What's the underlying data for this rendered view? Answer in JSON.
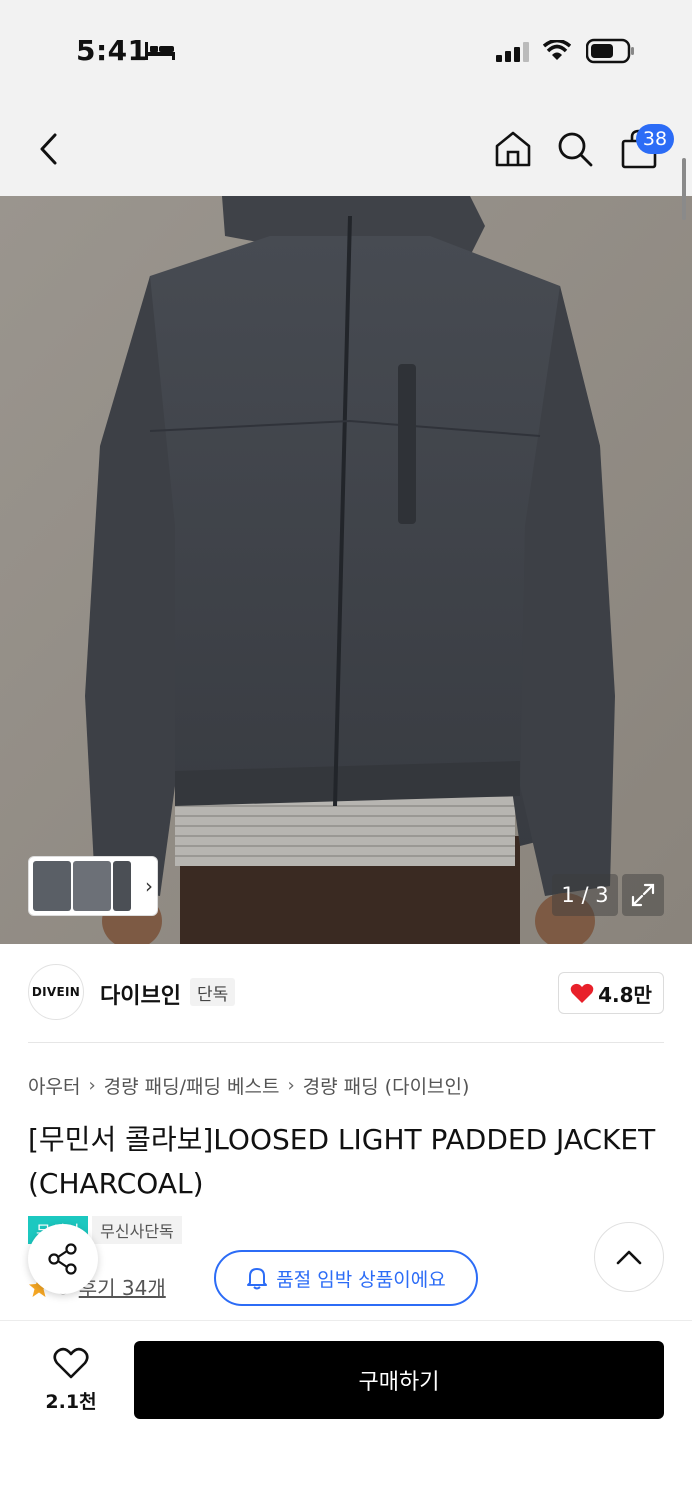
{
  "status_bar": {
    "time": "5:41"
  },
  "nav": {
    "cart_count": "38"
  },
  "gallery": {
    "page_indicator": "1 / 3"
  },
  "brand": {
    "logo_text": "DIVEIN",
    "name": "다이브인",
    "tag": "단독",
    "like_count": "4.8만"
  },
  "breadcrumb": [
    "아우터",
    "경량 패딩/패딩 베스트",
    "경량 패딩 (다이브인)"
  ],
  "product": {
    "title": "[무민서 콜라보]LOOSED LIGHT PADDED JACKET (CHARCOAL)",
    "badge_primary": "무신사",
    "badge_secondary": "무신사단독",
    "rating_text": "5",
    "review_link": "후기 34개"
  },
  "floating": {
    "soldout_label": "품절 임박 상품이에요"
  },
  "bottom_bar": {
    "wish_count": "2.1천",
    "buy_label": "구매하기"
  },
  "colors": {
    "accent": "#2c6cf6",
    "teal": "#1cc8c0",
    "like_red": "#e8202a",
    "star": "#f5a623"
  }
}
